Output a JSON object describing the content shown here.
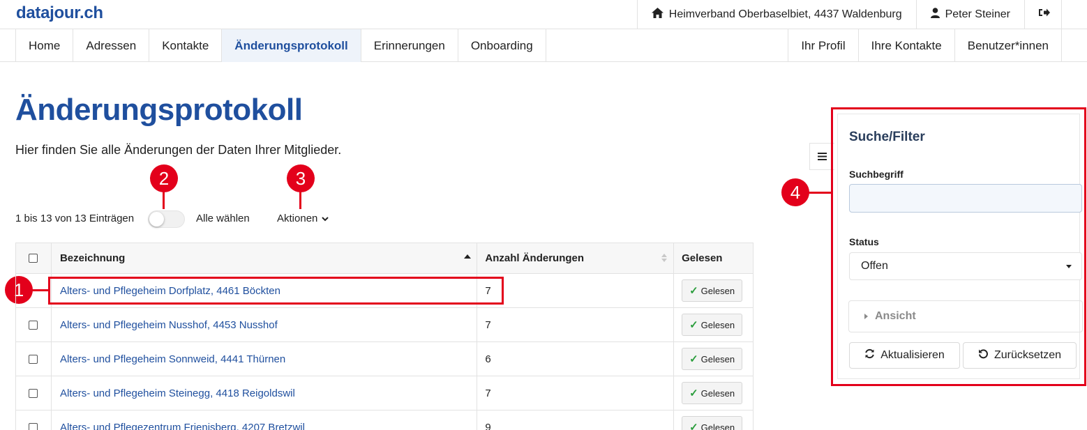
{
  "header": {
    "logo": "datajour.ch",
    "organisation": "Heimverband Oberbaselbiet, 4437 Waldenburg",
    "user": "Peter Steiner",
    "icons": {
      "home": "home-icon",
      "user": "user-icon",
      "logout": "logout-icon"
    }
  },
  "nav": {
    "left": [
      {
        "label": "Home",
        "active": false
      },
      {
        "label": "Adressen",
        "active": false
      },
      {
        "label": "Kontakte",
        "active": false
      },
      {
        "label": "Änderungsprotokoll",
        "active": true
      },
      {
        "label": "Erinnerungen",
        "active": false
      },
      {
        "label": "Onboarding",
        "active": false
      }
    ],
    "right": [
      {
        "label": "Ihr Profil"
      },
      {
        "label": "Ihre Kontakte"
      },
      {
        "label": "Benutzer*innen"
      }
    ]
  },
  "page": {
    "title": "Änderungsprotokoll",
    "intro": "Hier finden Sie alle Änderungen der Daten Ihrer Mitglieder."
  },
  "toolbar": {
    "count": "1 bis 13 von 13 Einträgen",
    "select_all": "Alle wählen",
    "select_all_on": false,
    "actions": "Aktionen"
  },
  "markers": {
    "m1": "1",
    "m2": "2",
    "m3": "3",
    "m4": "4"
  },
  "table": {
    "headers": {
      "name": "Bezeichnung",
      "count": "Anzahl Änderungen",
      "read": "Gelesen"
    },
    "read_button": "Gelesen",
    "rows": [
      {
        "name": "Alters- und Pflegeheim Dorfplatz, 4461 Böckten",
        "count": "7"
      },
      {
        "name": "Alters- und Pflegeheim Nusshof, 4453 Nusshof",
        "count": "7"
      },
      {
        "name": "Alters- und Pflegeheim Sonnweid, 4441 Thürnen",
        "count": "6"
      },
      {
        "name": "Alters- und Pflegeheim Steinegg, 4418 Reigoldswil",
        "count": "7"
      },
      {
        "name": "Alters- und Pflegezentrum Frienisberg, 4207 Bretzwil",
        "count": "9"
      }
    ]
  },
  "filter": {
    "title": "Suche/Filter",
    "search_label": "Suchbegriff",
    "search_value": "",
    "status_label": "Status",
    "status_value": "Offen",
    "view_label": "Ansicht",
    "refresh_label": "Aktualisieren",
    "reset_label": "Zurücksetzen"
  },
  "colors": {
    "brand": "#1f4f9e",
    "marker": "#e3001b",
    "check": "#2a9d3c"
  }
}
